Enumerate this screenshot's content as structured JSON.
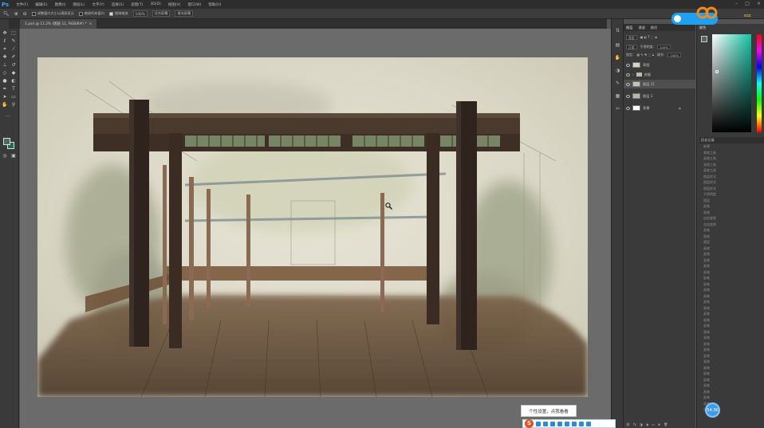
{
  "app": {
    "logo": "Ps"
  },
  "menu": [
    "文件(F)",
    "编辑(E)",
    "图像(I)",
    "图层(L)",
    "文字(Y)",
    "选择(S)",
    "滤镜(T)",
    "3D(D)",
    "视图(V)",
    "窗口(W)",
    "帮助(H)"
  ],
  "options": {
    "resize_windows": "调整窗口大小以满屏显示",
    "zoom_all": "缩放所有窗口",
    "scrubby_zoom": "细微缩放",
    "zoom_value": "100%",
    "fit_screen": "适合屏幕",
    "fill_screen": "填充屏幕"
  },
  "document": {
    "tab_label": "1.psd @ 11.2% (图层 11, RGB/8#) *",
    "close": "×"
  },
  "layers_panel": {
    "tabs": [
      "图层",
      "通道",
      "路径"
    ],
    "kind_label": "类型",
    "blend_mode": "正常",
    "opacity_label": "不透明度:",
    "opacity_value": "100%",
    "lock_label": "锁定:",
    "fill_label": "填充:",
    "fill_value": "100%",
    "layers": [
      {
        "name": "草图",
        "type": "layer",
        "selected": false
      },
      {
        "name": "房屋",
        "type": "group",
        "selected": false
      },
      {
        "name": "图层 11",
        "type": "layer",
        "selected": true
      },
      {
        "name": "图层 1",
        "type": "layer",
        "selected": false
      },
      {
        "name": "背景",
        "type": "layer",
        "selected": false
      }
    ]
  },
  "color_panel": {
    "title": "颜色",
    "hue_color": "#13c5a6"
  },
  "history_panel": {
    "title": "历史记录",
    "items": [
      "新建",
      "画笔工具",
      "画笔工具",
      "画笔工具",
      "画笔工具",
      "图层样式",
      "图层样式",
      "图层样式",
      "不透明度",
      "图层",
      "画笔",
      "画笔",
      "自由变换",
      "自由变换",
      "画笔",
      "画笔",
      "图层",
      "画笔",
      "画笔",
      "画笔",
      "画笔",
      "画笔",
      "画笔",
      "画笔",
      "画笔",
      "画笔",
      "画笔",
      "画笔",
      "画笔",
      "画笔",
      "画笔",
      "画笔",
      "画笔",
      "画笔",
      "画笔",
      "画笔",
      "画笔",
      "画笔",
      "画笔",
      "画笔",
      "画笔",
      "画笔",
      "画笔",
      "画笔",
      "画笔"
    ]
  },
  "overlay": {
    "tooltip": "个性设置，点我看看",
    "ime_logo": "S",
    "bubble_value": "54.3K"
  }
}
